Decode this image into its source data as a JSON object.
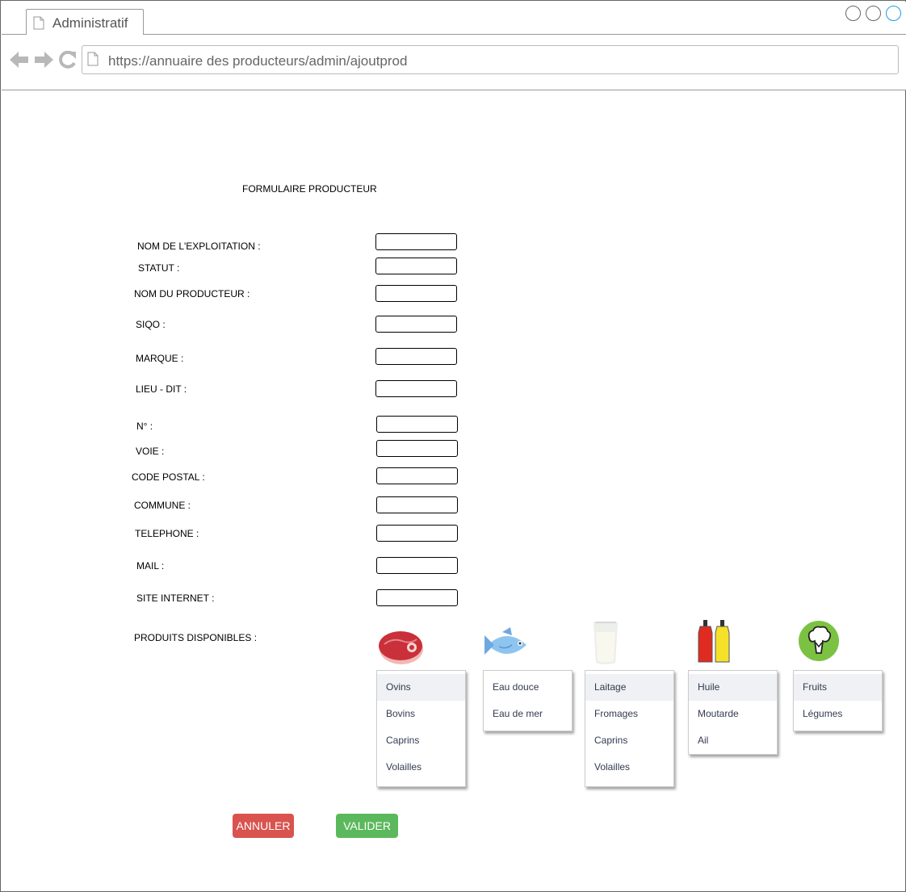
{
  "browser": {
    "tab_title": "Administratif",
    "url": "https://annuaire des producteurs/admin/ajoutprod"
  },
  "form": {
    "title": "FORMULAIRE PRODUCTEUR",
    "fields": {
      "exploitation": "NOM DE L'EXPLOITATION :",
      "statut": "STATUT :",
      "producteur": "NOM DU PRODUCTEUR :",
      "siqo": "SIQO :",
      "marque": "MARQUE :",
      "lieu_dit": "LIEU - DIT :",
      "numero": "N° :",
      "voie": "VOIE :",
      "code_postal": "CODE POSTAL :",
      "commune": "COMMUNE :",
      "telephone": "TELEPHONE :",
      "mail": "MAIL :",
      "site": "SITE INTERNET :"
    },
    "products_label": "PRODUITS DISPONIBLES :"
  },
  "products": {
    "viande": [
      "Ovins",
      "Bovins",
      "Caprins",
      "Volailles"
    ],
    "poisson": [
      "Eau douce",
      "Eau de mer"
    ],
    "laitier": [
      "Laitage",
      "Fromages",
      "Caprins",
      "Volailles"
    ],
    "condiments": [
      "Huile",
      "Moutarde",
      "Ail"
    ],
    "vegetaux": [
      "Fruits",
      "Légumes"
    ]
  },
  "icons": {
    "viande": "steak-icon",
    "poisson": "fish-icon",
    "laitier": "milk-glass-icon",
    "condiments": "sauce-bottles-icon",
    "vegetaux": "broccoli-icon"
  },
  "actions": {
    "cancel": "ANNULER",
    "submit": "VALIDER"
  },
  "colors": {
    "cancel": "#d9534f",
    "submit": "#5cb85c",
    "window_accent": "#1e9fe0"
  }
}
